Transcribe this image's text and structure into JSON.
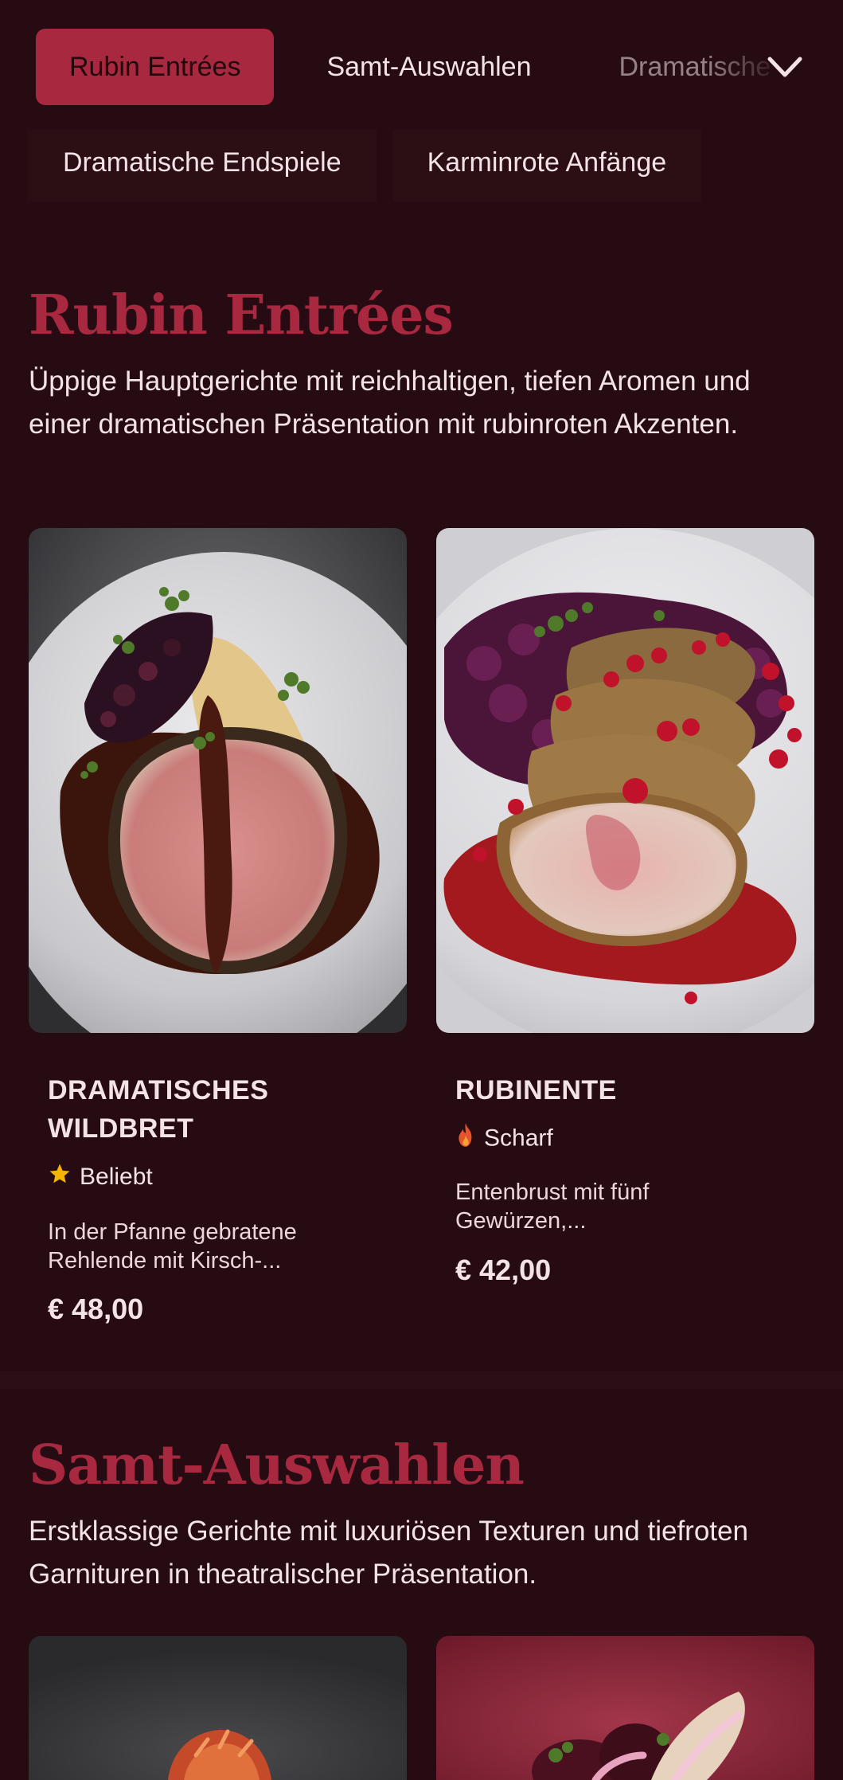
{
  "categories": {
    "tabs": [
      {
        "label": "Rubin Entrées",
        "active": true
      },
      {
        "label": "Samt-Auswahlen",
        "active": false
      },
      {
        "label": "Dramatische Endspiele",
        "active": false
      }
    ],
    "overflow_tabs": [
      {
        "label": "Dramatische Endspiele"
      },
      {
        "label": "Karminrote Anfänge"
      }
    ],
    "expand_icon": "chevron-down-icon"
  },
  "sections": [
    {
      "title": "Rubin Entrées",
      "description": "Üppige Hauptgerichte mit reichhaltigen, tiefen Aromen und einer dramatischen Präsentation mit rubinroten Akzenten.",
      "dishes": [
        {
          "name": "DRAMATISCHES WILDBRET",
          "tag": "Beliebt",
          "tag_icon": "star-icon",
          "description": "In der Pfanne gebratene Rehlende mit Kirsch-...",
          "price": "€ 48,00"
        },
        {
          "name": "RUBINENTE",
          "tag": "Scharf",
          "tag_icon": "flame-icon",
          "description": "Entenbrust mit fünf Gewürzen,...",
          "price": "€ 42,00"
        }
      ]
    },
    {
      "title": "Samt-Auswahlen",
      "description": "Erstklassige Gerichte mit luxuriösen Texturen und tiefroten Garnituren in theatralischer Präsentation."
    }
  ],
  "colors": {
    "background": "#260c12",
    "accent": "#a8283f",
    "text": "#f3e3e6",
    "star": "#f4b400",
    "flame": "#e8542a"
  }
}
